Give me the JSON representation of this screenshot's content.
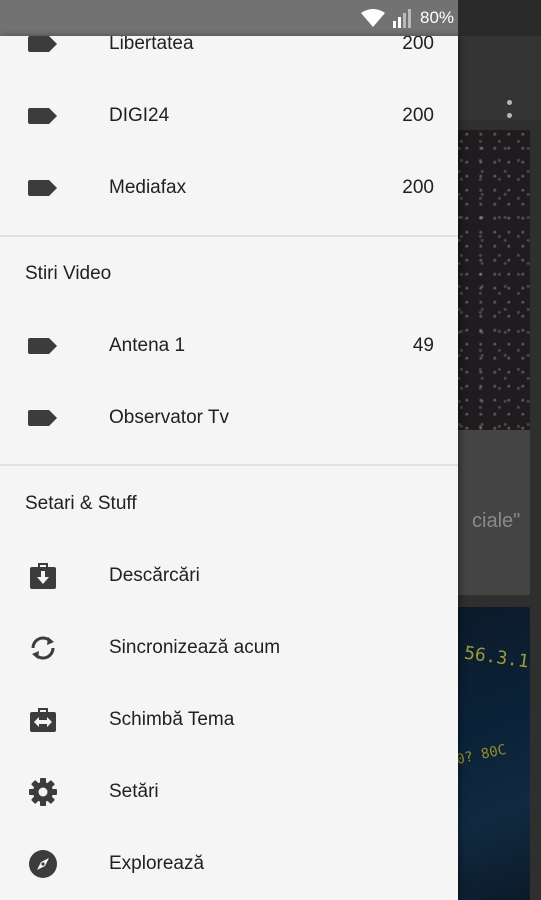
{
  "status_bar": {
    "battery": "80%"
  },
  "drawer": {
    "feeds": [
      {
        "label": "Libertatea",
        "count": "200",
        "icon": "label-icon"
      },
      {
        "label": "DIGI24",
        "count": "200",
        "icon": "label-icon"
      },
      {
        "label": "Mediafax",
        "count": "200",
        "icon": "label-icon"
      }
    ],
    "video_section": {
      "title": "Stiri Video",
      "items": [
        {
          "label": "Antena 1",
          "count": "49",
          "icon": "label-icon"
        },
        {
          "label": "Observator Tv",
          "count": "",
          "icon": "label-icon"
        }
      ]
    },
    "settings_section": {
      "title": "Setari & Stuff",
      "items": [
        {
          "label": "Descărcări",
          "icon": "download-icon"
        },
        {
          "label": "Sincronizează acum",
          "icon": "sync-icon"
        },
        {
          "label": "Schimbă Tema",
          "icon": "theme-swap-icon"
        },
        {
          "label": "Setări",
          "icon": "gear-icon"
        },
        {
          "label": "Explorează",
          "icon": "compass-icon"
        }
      ]
    }
  },
  "background": {
    "card1_text": "ciale\"",
    "card2_text": "56.3.1",
    "card2_text2": "0? 80C"
  },
  "colors": {
    "drawer_bg": "#f5f5f5",
    "text": "#212121",
    "icon": "#3c3c3c"
  }
}
